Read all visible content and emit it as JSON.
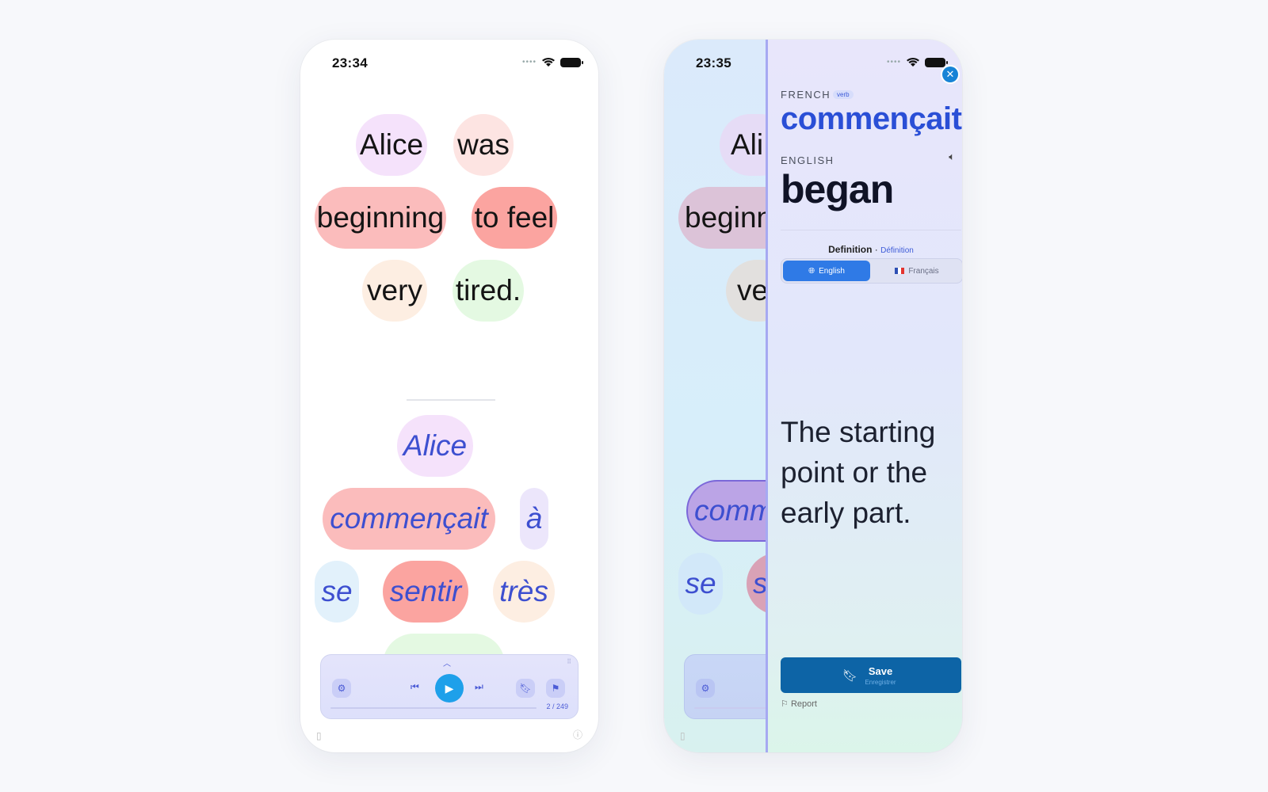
{
  "screen1": {
    "time": "23:34",
    "english_words": [
      {
        "text": "Alice",
        "color": "#f5e2fb"
      },
      {
        "text": "was",
        "color": "#fde4e2"
      },
      {
        "text": "beginning",
        "color": "#fbbcbc"
      },
      {
        "text": "to feel",
        "color": "#fba4a0"
      },
      {
        "text": "very",
        "color": "#fdeee2"
      },
      {
        "text": "tired.",
        "color": "#e4f9e2"
      }
    ],
    "french_words": [
      {
        "text": "Alice",
        "color": "#f5e2fb"
      },
      {
        "text": "commençait",
        "color": "#fbbcbc"
      },
      {
        "text": "à",
        "color": "#ece6fb"
      },
      {
        "text": "se",
        "color": "#e2f1fb"
      },
      {
        "text": "sentir",
        "color": "#fba4a0"
      },
      {
        "text": "très",
        "color": "#fdeee2"
      }
    ],
    "player": {
      "page_count": "2 / 249"
    }
  },
  "screen2": {
    "time": "23:35",
    "background_words": [
      "Ali",
      "beginn",
      "ve",
      "comm",
      "se",
      "s"
    ],
    "panel": {
      "source_language": "FRENCH",
      "part_of_speech": "verb",
      "source_word": "commençait",
      "target_language": "ENGLISH",
      "target_word": "began",
      "definition_title": "Definition",
      "definition_title_fr": "Définition",
      "tab_english": "English",
      "tab_french": "Français",
      "definition": "The starting point or the early part.",
      "save_label": "Save",
      "save_sublabel": "Enregistrer",
      "report_label": "Report"
    }
  },
  "colors": {
    "accent_blue": "#2f7ae6",
    "save_blue": "#0d64a6",
    "french_text": "#3d4fd0"
  }
}
